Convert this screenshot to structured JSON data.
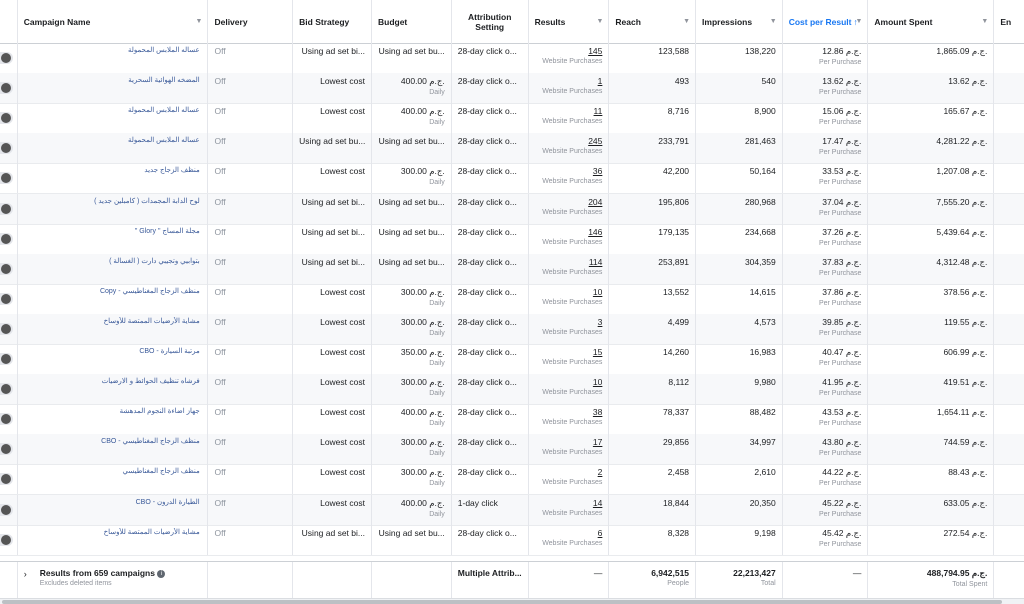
{
  "headers": {
    "campaign_name": "Campaign Name",
    "delivery": "Delivery",
    "bid_strategy": "Bid Strategy",
    "budget": "Budget",
    "attribution": "Attribution Setting",
    "results": "Results",
    "reach": "Reach",
    "impressions": "Impressions",
    "cost_per_result": "Cost per Result",
    "amount_spent": "Amount Spent",
    "extra": "En"
  },
  "result_unit": "Website Purchases",
  "cost_unit": "Per Purchase",
  "rows": [
    {
      "name": "عساله الملابس المحمولة",
      "delivery": "Off",
      "bid": "Using ad set bi...",
      "budget": "Using ad set bu...",
      "budget_sub": "",
      "attr": "28-day click o...",
      "results": "145",
      "reach": "123,588",
      "impressions": "138,220",
      "cpr": "12.86 ج.م.",
      "spent": "1,865.09 ج.م."
    },
    {
      "name": "المضخه الهوائية السحرية",
      "delivery": "Off",
      "bid": "Lowest cost",
      "budget": "400.00 ج.م.",
      "budget_sub": "Daily",
      "attr": "28-day click o...",
      "results": "1",
      "reach": "493",
      "impressions": "540",
      "cpr": "13.62 ج.م.",
      "spent": "13.62 ج.م."
    },
    {
      "name": "عساله الملابس المحمولة",
      "delivery": "Off",
      "bid": "Lowest cost",
      "budget": "400.00 ج.م.",
      "budget_sub": "Daily",
      "attr": "28-day click o...",
      "results": "11",
      "reach": "8,716",
      "impressions": "8,900",
      "cpr": "15.06 ج.م.",
      "spent": "165.67 ج.م."
    },
    {
      "name": "عساله الملابس المحمولة",
      "delivery": "Off",
      "bid": "Using ad set bu...",
      "budget": "Using ad set bu...",
      "budget_sub": "",
      "attr": "28-day click o...",
      "results": "245",
      "reach": "233,791",
      "impressions": "281,463",
      "cpr": "17.47 ج.م.",
      "spent": "4,281.22 ج.م."
    },
    {
      "name": "منظف الزجاج جديد",
      "delivery": "Off",
      "bid": "Lowest cost",
      "budget": "300.00 ج.م.",
      "budget_sub": "Daily",
      "attr": "28-day click o...",
      "results": "36",
      "reach": "42,200",
      "impressions": "50,164",
      "cpr": "33.53 ج.م.",
      "spent": "1,207.08 ج.م."
    },
    {
      "name": "لوح الدابة المجمدات ( كامبلين جديد )",
      "delivery": "Off",
      "bid": "Using ad set bi...",
      "budget": "Using ad set bu...",
      "budget_sub": "",
      "attr": "28-day click o...",
      "results": "204",
      "reach": "195,806",
      "impressions": "280,968",
      "cpr": "37.04 ج.م.",
      "spent": "7,555.20 ج.م."
    },
    {
      "name": "مجلة المساج \" Glory \"",
      "delivery": "Off",
      "bid": "Using ad set bi...",
      "budget": "Using ad set bu...",
      "budget_sub": "",
      "attr": "28-day click o...",
      "results": "146",
      "reach": "179,135",
      "impressions": "234,668",
      "cpr": "37.26 ج.م.",
      "spent": "5,439.64 ج.م."
    },
    {
      "name": "بتوابيي وتجيبي دارت ( الغسالة )",
      "delivery": "Off",
      "bid": "Using ad set bi...",
      "budget": "Using ad set bu...",
      "budget_sub": "",
      "attr": "28-day click o...",
      "results": "114",
      "reach": "253,891",
      "impressions": "304,359",
      "cpr": "37.83 ج.م.",
      "spent": "4,312.48 ج.م."
    },
    {
      "name": "منظف الزجاج المغناطيسي - Copy",
      "delivery": "Off",
      "bid": "Lowest cost",
      "budget": "300.00 ج.م.",
      "budget_sub": "Daily",
      "attr": "28-day click o...",
      "results": "10",
      "reach": "13,552",
      "impressions": "14,615",
      "cpr": "37.86 ج.م.",
      "spent": "378.56 ج.م."
    },
    {
      "name": "مشاية الأرضيات الممتصة للأوساخ",
      "delivery": "Off",
      "bid": "Lowest cost",
      "budget": "300.00 ج.م.",
      "budget_sub": "Daily",
      "attr": "28-day click o...",
      "results": "3",
      "reach": "4,499",
      "impressions": "4,573",
      "cpr": "39.85 ج.م.",
      "spent": "119.55 ج.م."
    },
    {
      "name": "مرتبة السيارة - CBO",
      "delivery": "Off",
      "bid": "Lowest cost",
      "budget": "350.00 ج.م.",
      "budget_sub": "Daily",
      "attr": "28-day click o...",
      "results": "15",
      "reach": "14,260",
      "impressions": "16,983",
      "cpr": "40.47 ج.م.",
      "spent": "606.99 ج.م."
    },
    {
      "name": "فرشاه تنظيف الحوائط و الارضيات",
      "delivery": "Off",
      "bid": "Lowest cost",
      "budget": "300.00 ج.م.",
      "budget_sub": "Daily",
      "attr": "28-day click o...",
      "results": "10",
      "reach": "8,112",
      "impressions": "9,980",
      "cpr": "41.95 ج.م.",
      "spent": "419.51 ج.م."
    },
    {
      "name": "جهاز اضاءة النجوم المدهشة",
      "delivery": "Off",
      "bid": "Lowest cost",
      "budget": "400.00 ج.م.",
      "budget_sub": "Daily",
      "attr": "28-day click o...",
      "results": "38",
      "reach": "78,337",
      "impressions": "88,482",
      "cpr": "43.53 ج.م.",
      "spent": "1,654.11 ج.م."
    },
    {
      "name": "منظف الزجاج المغناطيسي - CBO",
      "delivery": "Off",
      "bid": "Lowest cost",
      "budget": "300.00 ج.م.",
      "budget_sub": "Daily",
      "attr": "28-day click o...",
      "results": "17",
      "reach": "29,856",
      "impressions": "34,997",
      "cpr": "43.80 ج.م.",
      "spent": "744.59 ج.م."
    },
    {
      "name": "منظف الزجاج المغناطيسي",
      "delivery": "Off",
      "bid": "Lowest cost",
      "budget": "300.00 ج.م.",
      "budget_sub": "Daily",
      "attr": "28-day click o...",
      "results": "2",
      "reach": "2,458",
      "impressions": "2,610",
      "cpr": "44.22 ج.م.",
      "spent": "88.43 ج.م."
    },
    {
      "name": "الطيارة الدرون - CBO",
      "delivery": "Off",
      "bid": "Lowest cost",
      "budget": "400.00 ج.م.",
      "budget_sub": "Daily",
      "attr": "1-day click",
      "results": "14",
      "reach": "18,844",
      "impressions": "20,350",
      "cpr": "45.22 ج.م.",
      "spent": "633.05 ج.م."
    },
    {
      "name": "مشاية الأرضيات الممتصة للأوساخ",
      "delivery": "Off",
      "bid": "Using ad set bi...",
      "budget": "Using ad set bu...",
      "budget_sub": "",
      "attr": "28-day click o...",
      "results": "6",
      "reach": "8,328",
      "impressions": "9,198",
      "cpr": "45.42 ج.م.",
      "spent": "272.54 ج.م."
    }
  ],
  "footer": {
    "title": "Results from 659 campaigns",
    "subtitle": "Excludes deleted items",
    "attribution": "Multiple Attrib...",
    "results": "—",
    "reach": "6,942,515",
    "reach_sub": "People",
    "impressions": "22,213,427",
    "impressions_sub": "Total",
    "cpr": "—",
    "spent": "488,794.95 ج.م.",
    "spent_sub": "Total Spent"
  }
}
